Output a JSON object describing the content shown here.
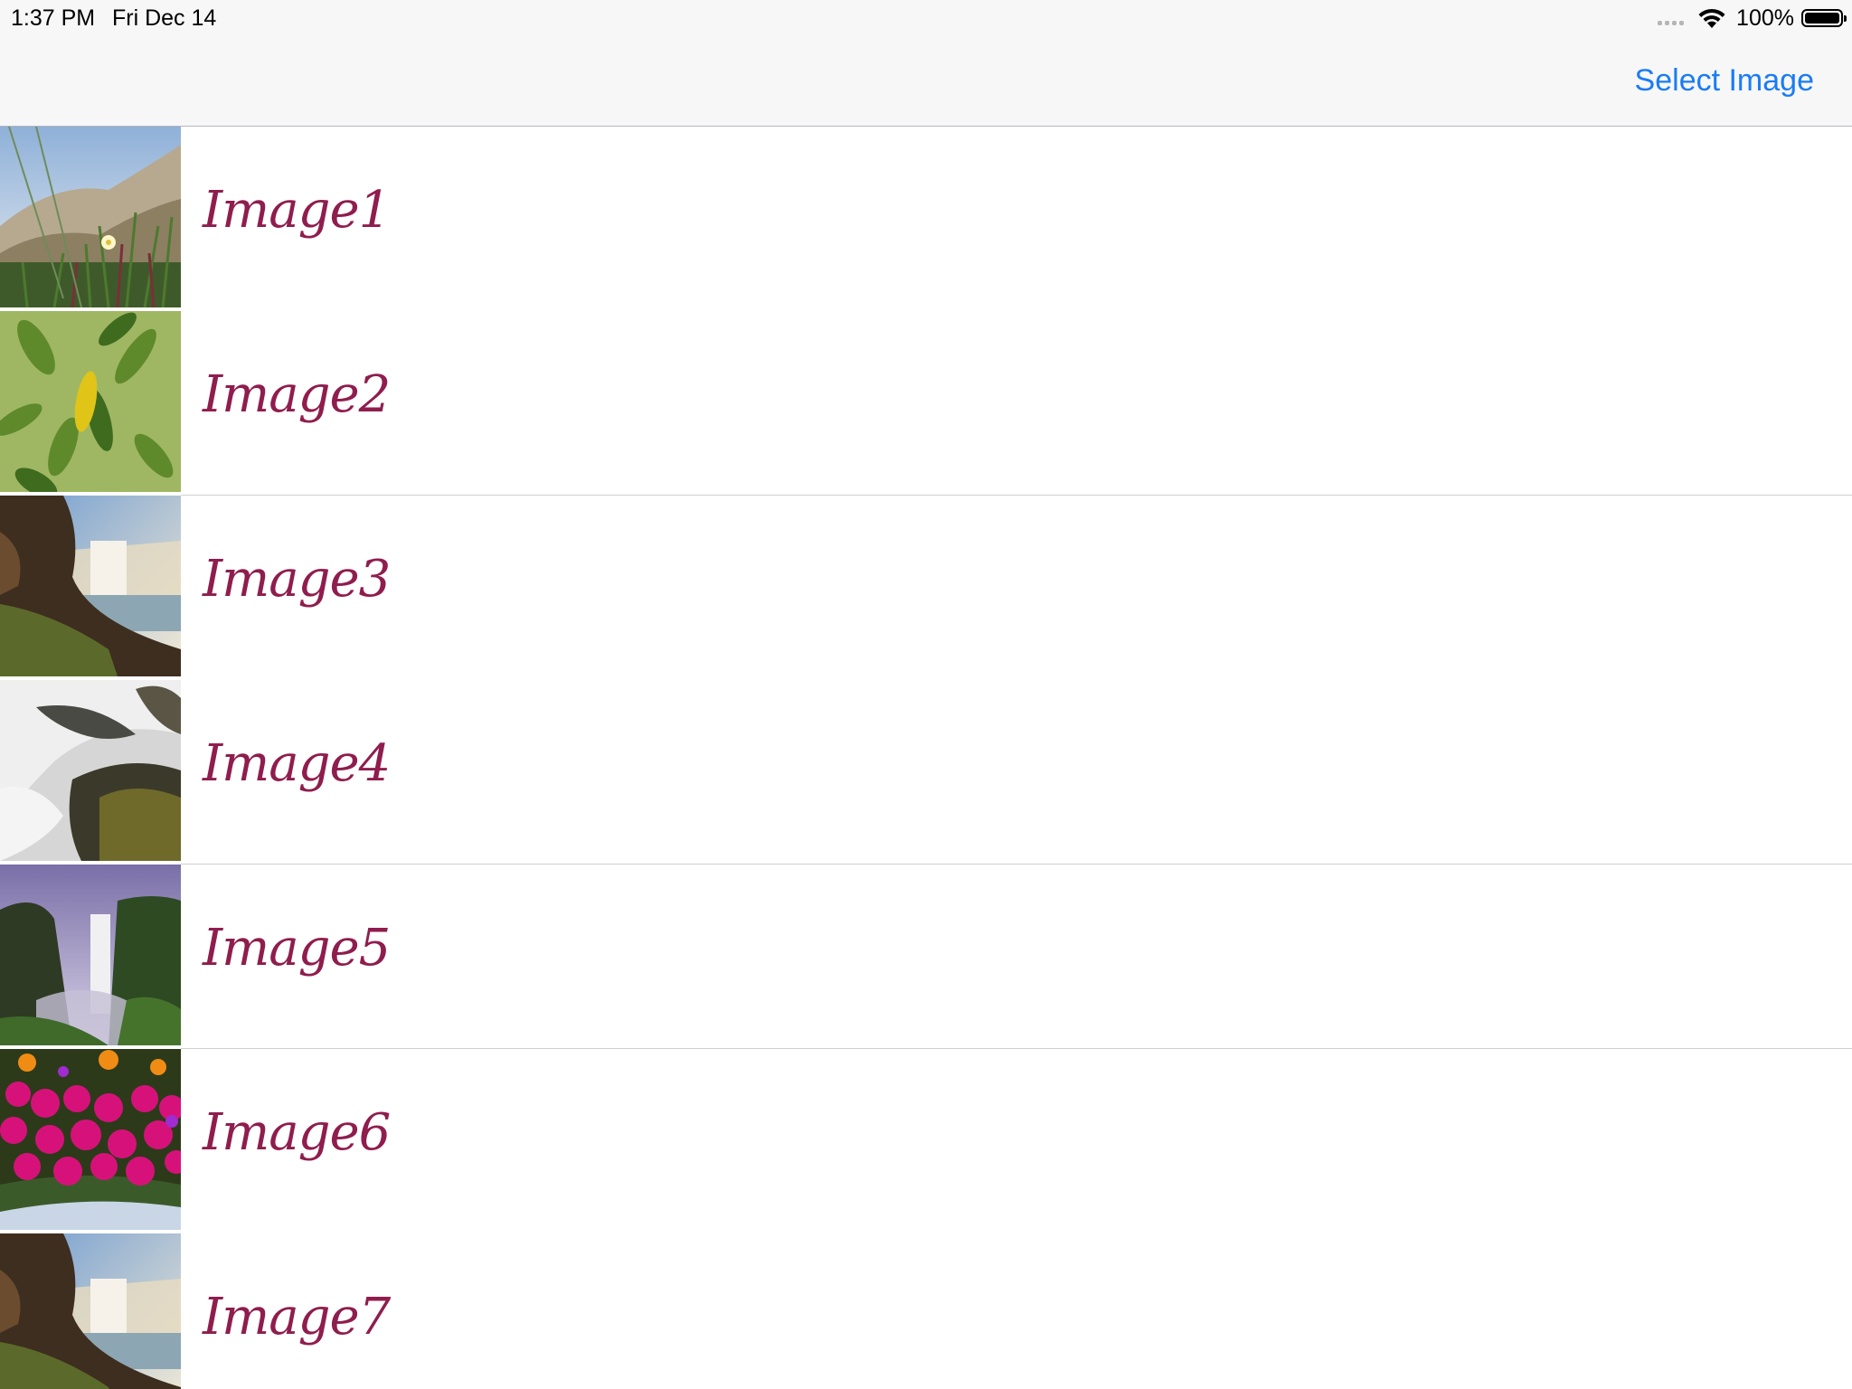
{
  "status_bar": {
    "time": "1:37 PM",
    "date": "Fri Dec 14",
    "battery_percent": "100%",
    "icons": [
      "cellular-signal-icon",
      "wifi-icon",
      "battery-icon"
    ]
  },
  "nav_bar": {
    "right_button_label": "Select Image",
    "accent_color": "#1a7cf5"
  },
  "table": {
    "label_color": "#8f1d4e",
    "rows": [
      {
        "label": "Image1",
        "thumbnail": "dune-grass-flower"
      },
      {
        "label": "Image2",
        "thumbnail": "green-leaves"
      },
      {
        "label": "Image3",
        "thumbnail": "waterfall-cliff"
      },
      {
        "label": "Image4",
        "thumbnail": "rushing-water-rocks"
      },
      {
        "label": "Image5",
        "thumbnail": "tall-waterfall-mist"
      },
      {
        "label": "Image6",
        "thumbnail": "pink-flowers"
      },
      {
        "label": "Image7",
        "thumbnail": "waterfall-cliff"
      }
    ]
  }
}
